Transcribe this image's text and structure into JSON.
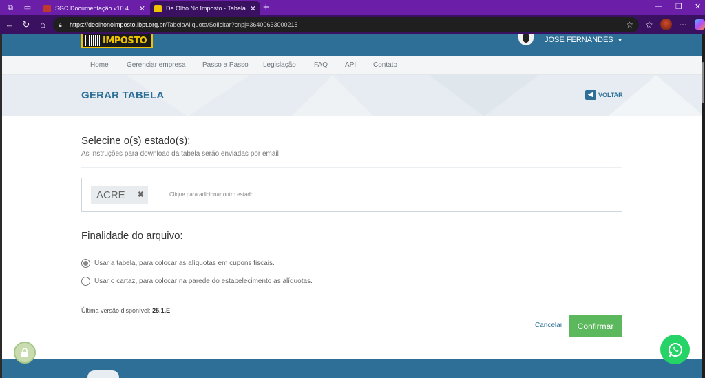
{
  "browser": {
    "tabs": [
      {
        "title": "SGC Documentação v10.4",
        "active": false,
        "favicon_color": "#c0392b"
      },
      {
        "title": "De Olho No Imposto - Tabela de A",
        "active": true,
        "favicon_color": "#f0c300"
      }
    ],
    "url_host": "https://deolhonoimposto.ibpt.org.br",
    "url_path": "/TabelaAliquota/Solicitar?cnpj=36400633000215"
  },
  "site": {
    "logo_text": "IMPOSTO",
    "user_name": "JOSE FERNANDES",
    "nav": [
      "Home",
      "Gerenciar empresa",
      "Passo a Passo",
      "Legislação",
      "FAQ",
      "API",
      "Contato"
    ],
    "page_title": "GERAR TABELA",
    "back_label": "VOLTAR"
  },
  "form": {
    "states_title": "Selecine o(s) estado(s):",
    "states_subtitle": "As instruções para download da tabela serão enviadas por email",
    "selected_state": "ACRE",
    "add_state_placeholder": "Clique para adicionar outro estado",
    "purpose_title": "Finalidade do arquivo:",
    "options": [
      {
        "label": "Usar a tabela, para colocar as alíquotas em cupons fiscais.",
        "checked": true
      },
      {
        "label": "Usar o cartaz, para colocar na parede do estabelecimento as alíquotas.",
        "checked": false
      }
    ],
    "version_label": "Última versão disponível:",
    "version_value": "25.1.E",
    "cancel_label": "Cancelar",
    "confirm_label": "Confirmar"
  },
  "colors": {
    "brand_blue": "#2d6f97",
    "confirm_green": "#5cb85c",
    "whatsapp_green": "#25d366",
    "browser_purple": "#6b1fa8"
  }
}
